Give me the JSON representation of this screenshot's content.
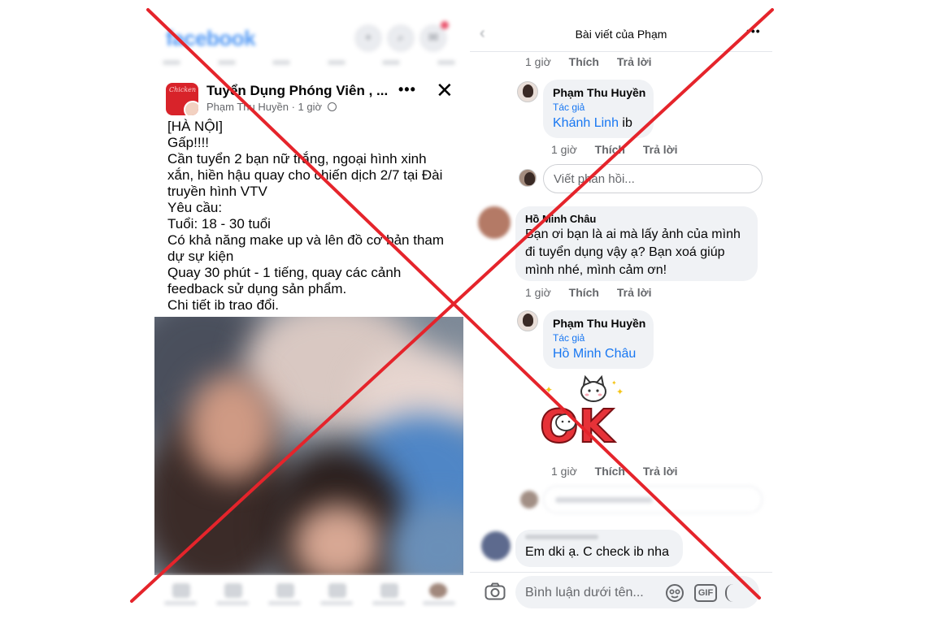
{
  "left_panel": {
    "brand": "facebook",
    "top_icons": [
      "add-icon",
      "search-icon",
      "messenger-icon"
    ],
    "post": {
      "group_name": "Tuyển Dụng Phóng Viên , ...",
      "author": "Phạm Thu Huyền",
      "time": "1 giờ",
      "more_label": "•••",
      "close_label": "✕",
      "body_lines": [
        "[HÀ NỘI]",
        "Gấp!!!!",
        "Cần tuyển 2 bạn nữ trắng, ngoại hình xinh",
        "xắn, hiền hậu quay cho chiến dịch 2/7 tại Đài",
        "truyền hình VTV",
        "Yêu cầu:",
        "Tuổi: 18 - 30 tuổi",
        "Có khả năng make up và lên đồ cơ bản tham",
        "dự sự kiện",
        "Quay 30 phút - 1 tiếng, quay các cảnh",
        "feedback sử dụng sản phẩm.",
        "Chi tiết ib trao đổi."
      ]
    }
  },
  "right_panel": {
    "header": {
      "back_label": "‹",
      "title": "Bài viết của Phạm",
      "more_label": "•••"
    },
    "top_meta": {
      "time": "1 giờ",
      "like": "Thích",
      "reply": "Trả lời"
    },
    "reply_1": {
      "name": "Phạm Thu Huyền",
      "badge": "Tác giả",
      "tag": "Khánh Linh",
      "text": " ib",
      "meta": {
        "time": "1 giờ",
        "like": "Thích",
        "reply": "Trả lời"
      }
    },
    "write_reply_placeholder": "Viết phản hồi...",
    "comment_chau": {
      "name": "Hồ Minh Châu",
      "lines": [
        "Bạn ơi bạn là ai mà lấy ảnh của mình",
        "đi tuyển dụng vậy ạ? Bạn xoá giúp",
        "mình nhé, mình cảm ơn!"
      ],
      "meta": {
        "time": "1 giờ",
        "like": "Thích",
        "reply": "Trả lời"
      }
    },
    "reply_2": {
      "name": "Phạm Thu Huyền",
      "badge": "Tác giả",
      "tag": "Hồ Minh Châu",
      "sticker_text": "OK",
      "meta": {
        "time": "1 giờ",
        "like": "Thích",
        "reply": "Trả lời"
      }
    },
    "comment_last": {
      "text": "Em dki ạ. C check ib nha"
    },
    "composer": {
      "placeholder": "Bình luận dưới tên...",
      "gif_label": "GIF"
    }
  },
  "overlay": {
    "color": "#e5242b",
    "meaning": "cross-out-mark"
  }
}
